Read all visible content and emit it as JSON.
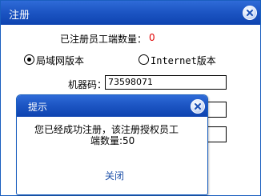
{
  "window": {
    "title": "注册"
  },
  "registration": {
    "count_label": "已注册员工端数量：",
    "count_value": "0",
    "option_lan": "局域网版本",
    "option_internet": "Internet版本",
    "selected": "lan",
    "machine_label": "机器码：",
    "machine_value": "73598071"
  },
  "dialog": {
    "title": "提示",
    "message_line1": "您已经成功注册，该注册授权员工",
    "message_line2": "端数量:50",
    "close_label": "关闭"
  },
  "colors": {
    "titlebar": "#1d56c4",
    "count_value": "#e00000",
    "link": "#1c4fa8"
  }
}
